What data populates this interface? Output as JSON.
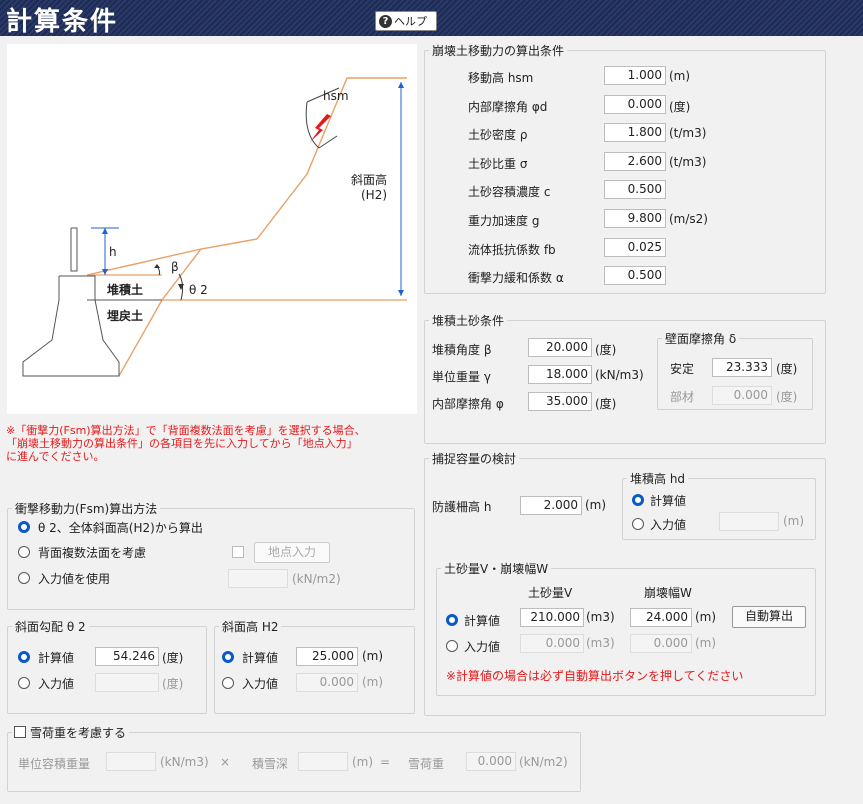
{
  "header": {
    "title": "計算条件",
    "help_label": "ヘルプ"
  },
  "diagram": {
    "hsm": "hsm",
    "h": "h",
    "beta": "β",
    "theta2": "θ 2",
    "slope_height_1": "斜面高",
    "slope_height_2": "(H2)",
    "deposit": "堆積土",
    "fill": "埋戻土"
  },
  "collapse": {
    "legend": "崩壊土移動力の算出条件",
    "rows": [
      {
        "label": "移動高 hsm",
        "value": "1.000",
        "unit": "(m)"
      },
      {
        "label": "内部摩擦角 φd",
        "value": "0.000",
        "unit": "(度)"
      },
      {
        "label": "土砂密度 ρ",
        "value": "1.800",
        "unit": "(t/m3)"
      },
      {
        "label": "土砂比重 σ",
        "value": "2.600",
        "unit": "(t/m3)"
      },
      {
        "label": "土砂容積濃度 c",
        "value": "0.500",
        "unit": ""
      },
      {
        "label": "重力加速度 g",
        "value": "9.800",
        "unit": "(m/s2)"
      },
      {
        "label": "流体抵抗係数 fb",
        "value": "0.025",
        "unit": ""
      },
      {
        "label": "衝撃力緩和係数 α",
        "value": "0.500",
        "unit": ""
      }
    ]
  },
  "deposit": {
    "legend": "堆積土砂条件",
    "rows": [
      {
        "label": "堆積角度 β",
        "value": "20.000",
        "unit": "(度)"
      },
      {
        "label": "単位重量 γ",
        "value": "18.000",
        "unit": "(kN/m3)"
      },
      {
        "label": "内部摩擦角 φ",
        "value": "35.000",
        "unit": "(度)"
      }
    ],
    "wall": {
      "legend": "壁面摩擦角 δ",
      "stable_label": "安定",
      "stable_value": "23.333",
      "stable_unit": "(度)",
      "member_label": "部材",
      "member_value": "0.000",
      "member_unit": "(度)"
    }
  },
  "note": "※「衝撃力(Fsm)算出方法」で「背面複数法面を考慮」を選択する場合、「崩壊土移動力の算出条件」の各項目を先に入力してから「地点入力」に進んでください。",
  "note_lines": [
    "※「衝撃力(Fsm)算出方法」で「背面複数法面を考慮」を選択する場合、",
    "「崩壊土移動力の算出条件」の各項目を先に入力してから「地点入力」",
    "に進んでください。"
  ],
  "method": {
    "legend": "衝撃移動力(Fsm)算出方法",
    "opt1": "θ 2、全体斜面高(H2)から算出",
    "opt2": "背面複数法面を考慮",
    "opt3": "入力値を使用",
    "point_button": "地点入力",
    "unit": "(kN/m2)"
  },
  "slope_angle": {
    "legend": "斜面勾配 θ 2",
    "calc": "計算値",
    "calc_value": "54.246",
    "calc_unit": "(度)",
    "input": "入力値",
    "input_unit": "(度)"
  },
  "slope_height": {
    "legend": "斜面高 H2",
    "calc": "計算値",
    "calc_value": "25.000",
    "calc_unit": "(m)",
    "input": "入力値",
    "input_value": "0.000",
    "input_unit": "(m)"
  },
  "capture": {
    "legend": "捕捉容量の検討",
    "fence_label": "防護柵高 h",
    "fence_value": "2.000",
    "fence_unit": "(m)",
    "hd": {
      "legend": "堆積高 hd",
      "calc": "計算値",
      "input": "入力値",
      "unit": "(m)"
    },
    "vol": {
      "legend": "土砂量V・崩壊幅W",
      "col1": "土砂量V",
      "col2": "崩壊幅W",
      "calc": "計算値",
      "calc_v": "210.000",
      "calc_v_unit": "(m3)",
      "calc_w": "24.000",
      "calc_w_unit": "(m)",
      "auto_button": "自動算出",
      "input": "入力値",
      "in_v": "0.000",
      "in_v_unit": "(m3)",
      "in_w": "0.000",
      "in_w_unit": "(m)",
      "warning": "※計算値の場合は必ず自動算出ボタンを押してください"
    }
  },
  "snow": {
    "label": "雪荷重を考慮する",
    "unit_weight": "単位容積重量",
    "uw_unit": "(kN/m3)",
    "times": "×",
    "depth": "積雪深",
    "depth_unit": "(m)",
    "equals": "=",
    "load": "雪荷重",
    "load_value": "0.000",
    "load_unit": "(kN/m2)"
  },
  "colors": {
    "accent": "#0a59c6",
    "warning": "#e8191b",
    "slope_line": "#e8a167",
    "dim_line": "#2060d0"
  }
}
